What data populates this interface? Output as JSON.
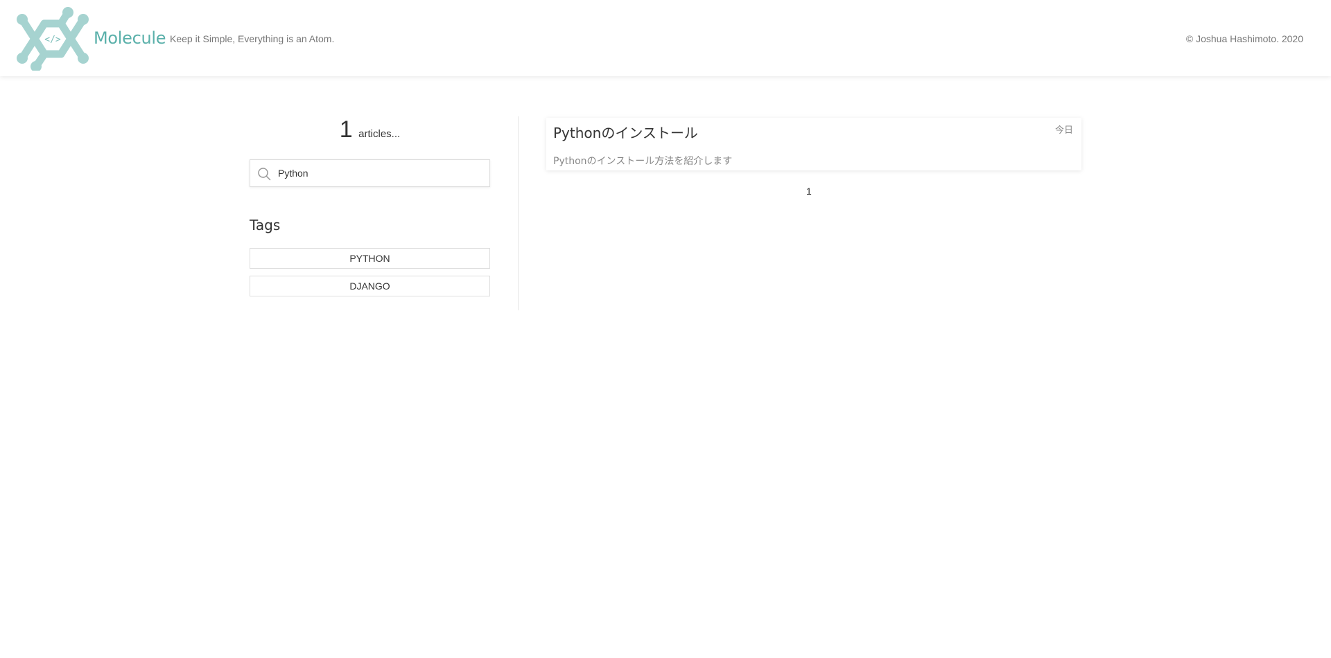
{
  "header": {
    "brand": "Molecule",
    "tagline": "Keep it Simple, Everything is an Atom.",
    "copyright": "© Joshua Hashimoto. 2020",
    "logo_icon": "molecule-hexagon-code-icon",
    "logo_text": "</>",
    "brand_color": "#5ab0aa",
    "logo_color": "#a6d3d0"
  },
  "sidebar": {
    "count": "1",
    "count_label": "articles...",
    "search": {
      "value": "Python",
      "placeholder": "",
      "icon": "search-icon"
    },
    "tags_title": "Tags",
    "tags": [
      {
        "label": "PYTHON"
      },
      {
        "label": "DJANGO"
      }
    ]
  },
  "articles": [
    {
      "title": "Pythonのインストール",
      "date": "今日",
      "summary": "Pythonのインストール方法を紹介します"
    }
  ],
  "pagination": {
    "current": "1"
  }
}
